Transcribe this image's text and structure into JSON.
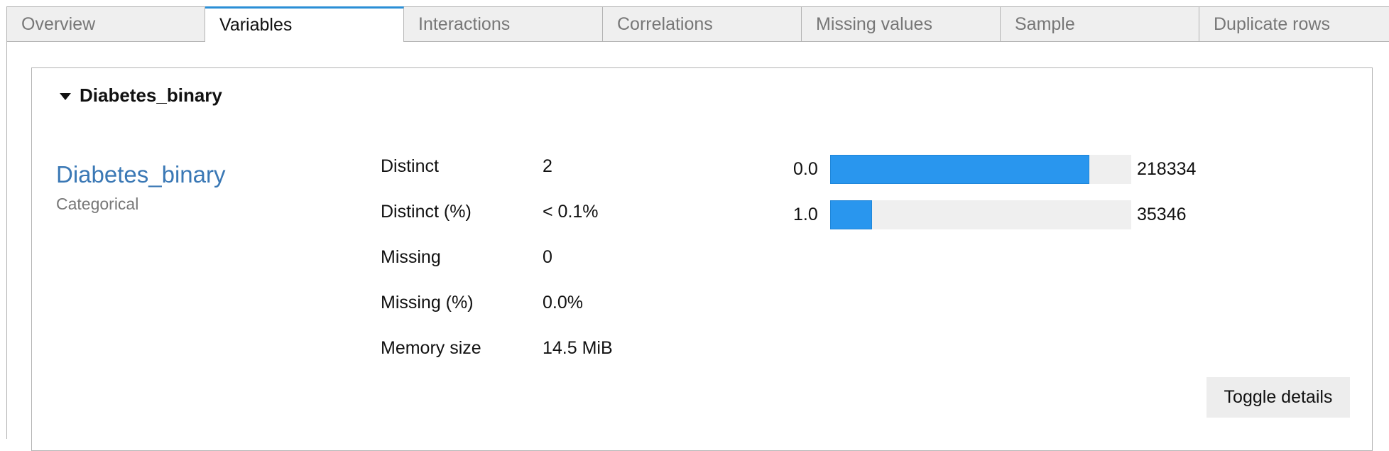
{
  "tabs": [
    {
      "label": "Overview",
      "active": false
    },
    {
      "label": "Variables",
      "active": true
    },
    {
      "label": "Interactions",
      "active": false
    },
    {
      "label": "Correlations",
      "active": false
    },
    {
      "label": "Missing values",
      "active": false
    },
    {
      "label": "Sample",
      "active": false
    },
    {
      "label": "Duplicate rows",
      "active": false
    }
  ],
  "section": {
    "title": "Diabetes_binary",
    "expanded": true
  },
  "variable": {
    "name": "Diabetes_binary",
    "type": "Categorical"
  },
  "stats": [
    {
      "label": "Distinct",
      "value": "2"
    },
    {
      "label": "Distinct (%)",
      "value": "< 0.1%"
    },
    {
      "label": "Missing",
      "value": "0"
    },
    {
      "label": "Missing (%)",
      "value": "0.0%"
    },
    {
      "label": "Memory size",
      "value": "14.5 MiB"
    }
  ],
  "frequencies": [
    {
      "label": "0.0",
      "count": "218334",
      "fraction": 0.86
    },
    {
      "label": "1.0",
      "count": "35346",
      "fraction": 0.14
    }
  ],
  "toggle_label": "Toggle details",
  "colors": {
    "accent": "#2b8fd6",
    "bar": "#2996ee",
    "link": "#3a78b5"
  }
}
